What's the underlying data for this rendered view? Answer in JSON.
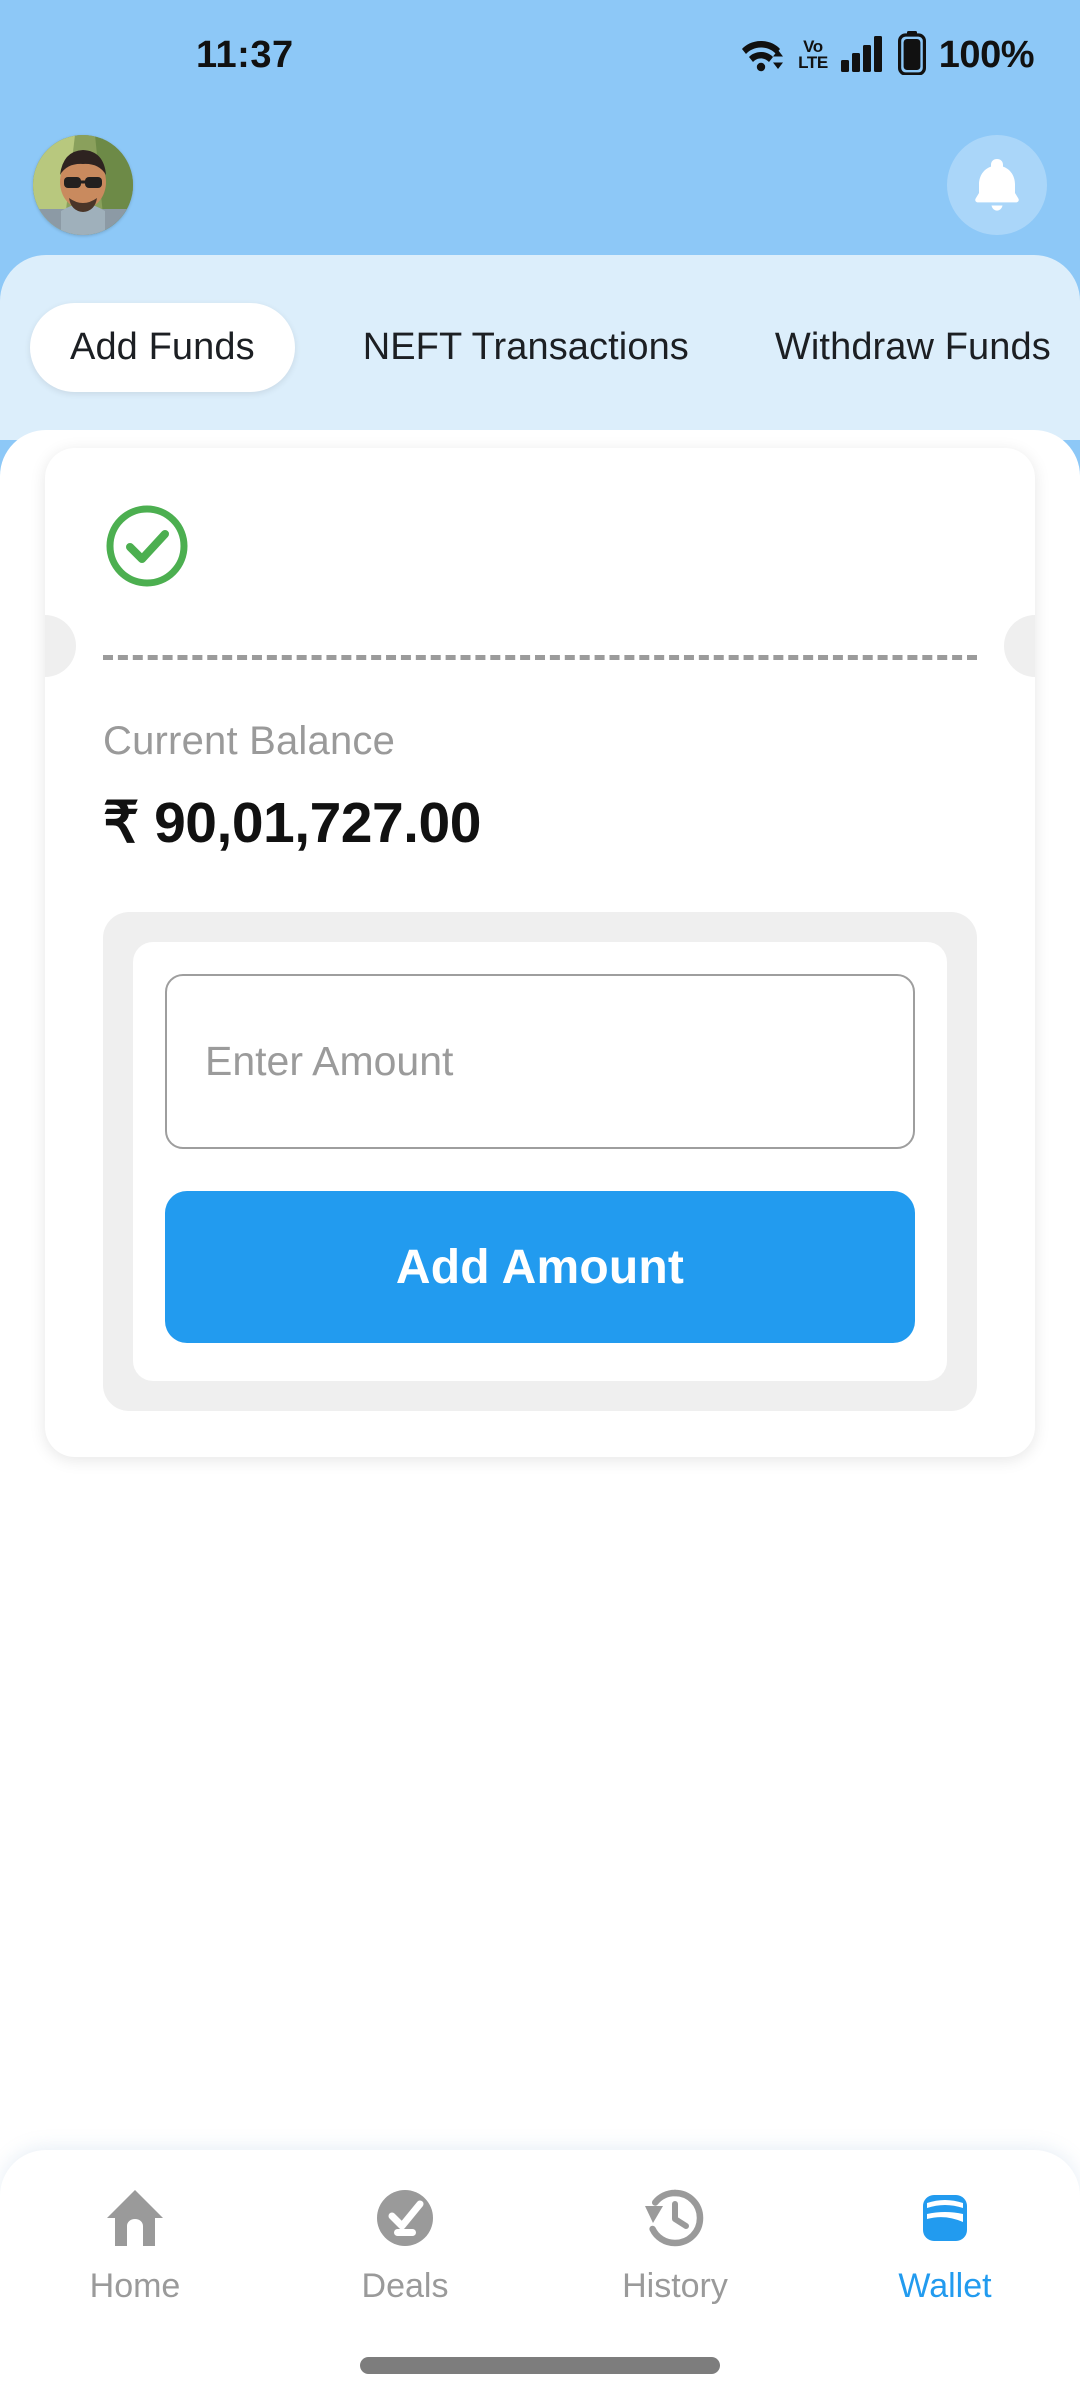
{
  "status_bar": {
    "time": "11:37",
    "wifi_icon": "wifi-icon",
    "network_label": "VoLTE",
    "network_label_top": "Vo",
    "network_label_bottom": "LTE",
    "signal_icon": "signal-bars-icon",
    "battery_icon": "battery-icon",
    "battery_percent": "100%"
  },
  "header": {
    "avatar_name": "user-avatar",
    "notification_icon": "bell-icon"
  },
  "tabs": {
    "items": [
      {
        "label": "Add Funds",
        "active": true
      },
      {
        "label": "NEFT Transactions",
        "active": false
      },
      {
        "label": "Withdraw Funds",
        "active": false
      }
    ]
  },
  "card": {
    "status_icon": "check-circle-icon",
    "status_color": "#4CAF50",
    "balance_label": "Current Balance",
    "balance_value": "₹ 90,01,727.00",
    "amount_input_value": "",
    "amount_input_placeholder": "Enter Amount",
    "submit_label": "Add Amount",
    "submit_color": "#229BEF"
  },
  "bottom_nav": {
    "items": [
      {
        "label": "Home",
        "icon": "home-icon",
        "active": false
      },
      {
        "label": "Deals",
        "icon": "deals-icon",
        "active": false
      },
      {
        "label": "History",
        "icon": "history-icon",
        "active": false
      },
      {
        "label": "Wallet",
        "icon": "wallet-icon",
        "active": true
      }
    ],
    "active_color": "#229BEF",
    "inactive_color": "#9a9a9a"
  },
  "theme": {
    "header_blue": "#8DC8F7",
    "tabstrip_blue": "#DCEEFB",
    "accent_blue": "#229BEF",
    "success_green": "#4CAF50",
    "muted_gray": "#9a9a9a"
  }
}
